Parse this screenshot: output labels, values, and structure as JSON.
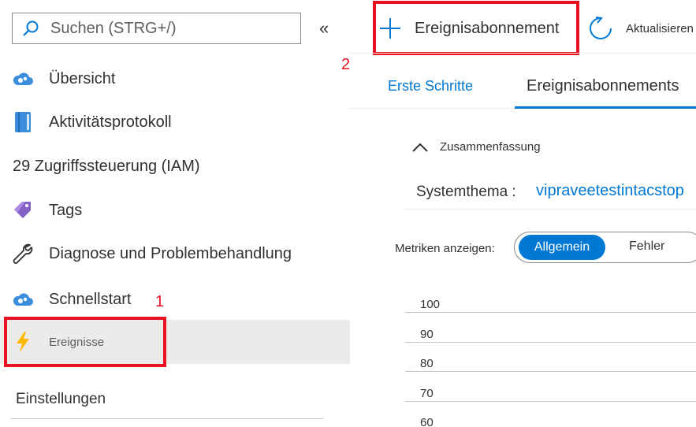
{
  "sidebar": {
    "search_placeholder": "Suchen (STRG+/)",
    "collapse_glyph": "«",
    "items": [
      {
        "label": "Übersicht",
        "icon": "cloud-gear-icon"
      },
      {
        "label": "Aktivitätsprotokoll",
        "icon": "book-icon"
      },
      {
        "label": "29 Zugriffssteuerung (IAM)",
        "icon": ""
      },
      {
        "label": "Tags",
        "icon": "tag-icon"
      },
      {
        "label": "Diagnose und Problembehandlung",
        "icon": "wrench-icon"
      },
      {
        "label": "Schnellstart",
        "icon": "cloud-gear-icon"
      },
      {
        "label": "Ereignisse",
        "icon": "lightning-icon",
        "selected": true
      }
    ],
    "section": "Einstellungen"
  },
  "callouts": {
    "one": "1",
    "two": "2"
  },
  "toolbar": {
    "add_label": "Ereignisabonnement",
    "refresh_label": "Aktualisieren"
  },
  "tabs": [
    "Erste Schritte",
    "Ereignisabonnements"
  ],
  "summary": {
    "label": "Zusammenfassung",
    "system_topic_label": "Systemthema :",
    "system_topic_value": "vipraveetestintacstop"
  },
  "metrics": {
    "label": "Metriken anzeigen:",
    "options": [
      "Allgemein",
      "Fehler"
    ],
    "selected": "Allgemein"
  },
  "chart_data": {
    "type": "line",
    "y_ticks": [
      "100",
      "90",
      "80",
      "70",
      "60"
    ]
  },
  "colors": {
    "accent": "#0078d4",
    "callout": "#e81123",
    "selected_bg": "#edebe9"
  }
}
